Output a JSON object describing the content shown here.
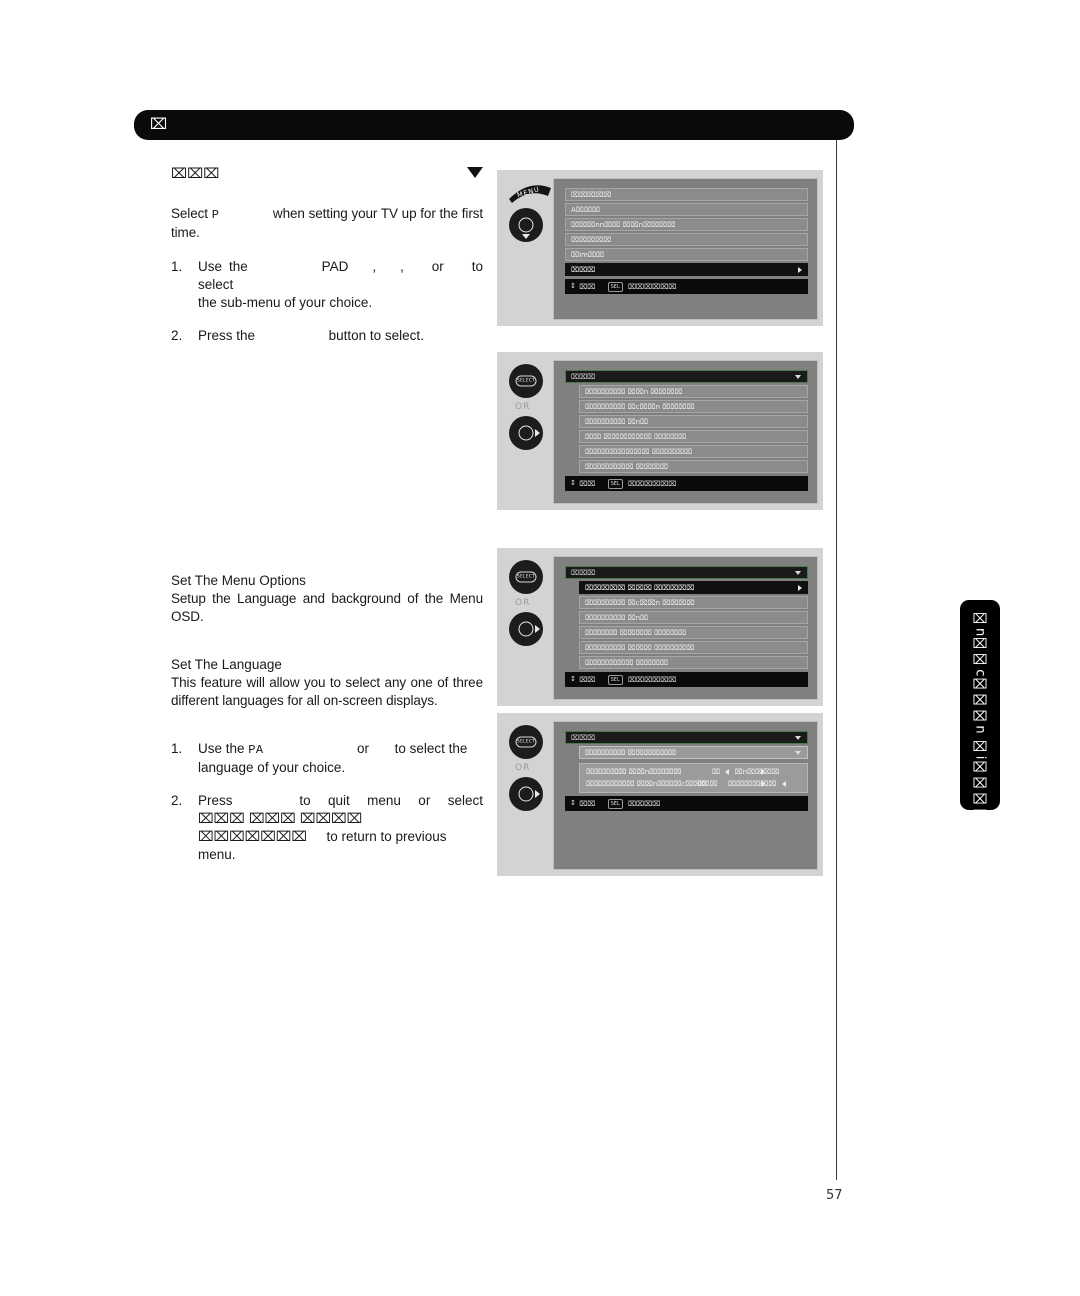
{
  "page": {
    "number": "57",
    "header_title": "⌧"
  },
  "side_tab": {
    "label": "⌧n⌧⌧c⌧⌧⌧n ⌧i⌧⌧⌧⌧"
  },
  "section": {
    "heading": "⌧⌧⌧",
    "intro_prefix": "Select",
    "intro_mono": "P",
    "intro_rest": "when setting your TV up for the first time.",
    "steps": [
      {
        "num": "1.",
        "line1_a": "Use the",
        "line1_b": "PAD",
        "line1_c": ",",
        "line1_d": ",",
        "line1_e": "or",
        "line1_f": "to select",
        "line2": "the sub-menu of your choice."
      },
      {
        "num": "2.",
        "line1_a": "Press the",
        "line1_b": "button to select."
      }
    ]
  },
  "menu_options": {
    "title": "Set The Menu Options",
    "body": "Setup the Language and background of the Menu OSD."
  },
  "language": {
    "title": "Set The Language",
    "body": "This feature will allow you to select any one of three different languages for all on-screen displays.",
    "steps": [
      {
        "num": "1.",
        "line1_a": "Use the",
        "line1_mono": "PA",
        "line1_b": "or",
        "line1_c": "to select the",
        "line2": "language of your choice."
      },
      {
        "num": "2.",
        "line1_a": "Press",
        "line1_b": "to quit menu or select",
        "line1_tofu": "⌧⌧⌧ ⌧⌧⌧ ⌧⌧⌧⌧",
        "line2_tofu": "⌧⌧⌧⌧⌧⌧⌧",
        "line2_b": "to return to previous menu."
      }
    ]
  },
  "figures": [
    {
      "name": "main-menu",
      "remote": {
        "menu_label": "MENU",
        "pad": "nav-pad-down"
      },
      "rows": [
        {
          "text": "⌧⌧⌧⌧⌧",
          "style": "plain"
        },
        {
          "text": "A⌧⌧⌧",
          "style": "plain"
        },
        {
          "text": "⌧⌧⌧nn⌧⌧ ⌧⌧n⌧⌧⌧⌧",
          "style": "plain"
        },
        {
          "text": "⌧⌧⌧⌧⌧",
          "style": "plain"
        },
        {
          "text": "⌧im⌧⌧",
          "style": "plain"
        },
        {
          "text": "⌧⌧⌧",
          "style": "hl",
          "caret": "right"
        }
      ],
      "footer": {
        "updown": "↕",
        "left": "⌧⌧",
        "key": "SEL",
        "right": "⌧⌧⌧⌧⌧⌧"
      }
    },
    {
      "name": "setup-submenu",
      "remote": {
        "select_label": "SELECT",
        "or_label": "OR",
        "pad": "nav-pad-right"
      },
      "header_row": {
        "text": "⌧⌧⌧",
        "caret": "down"
      },
      "rows": [
        {
          "text": "⌧⌧⌧⌧⌧ ⌧⌧n ⌧⌧⌧⌧",
          "style": "plain"
        },
        {
          "text": "⌧⌧⌧⌧⌧ ⌧c⌧⌧n ⌧⌧⌧⌧",
          "style": "plain"
        },
        {
          "text": "⌧⌧⌧⌧⌧ ⌧n⌧",
          "style": "plain"
        },
        {
          "text": "⌧⌧ ⌧⌧⌧⌧⌧⌧ ⌧⌧⌧⌧",
          "style": "plain"
        },
        {
          "text": "⌧⌧⌧⌧⌧⌧⌧⌧ ⌧⌧⌧⌧⌧",
          "style": "plain"
        },
        {
          "text": "⌧⌧⌧⌧⌧⌧ ⌧⌧⌧⌧",
          "style": "plain"
        }
      ],
      "footer": {
        "updown": "↕",
        "left": "⌧⌧",
        "key": "SEL",
        "right": "⌧⌧⌧⌧⌧⌧"
      }
    },
    {
      "name": "menu-options-submenu",
      "remote": {
        "select_label": "SELECT",
        "or_label": "OR",
        "pad": "nav-pad-right"
      },
      "header_row": {
        "text": "⌧⌧⌧",
        "caret": "down"
      },
      "rows": [
        {
          "text": "⌧⌧⌧⌧⌧ ⌧⌧⌧ ⌧⌧⌧⌧⌧",
          "style": "hl",
          "caret": "right"
        },
        {
          "text": "⌧⌧⌧⌧⌧ ⌧c⌧⌧n ⌧⌧⌧⌧",
          "style": "plain"
        },
        {
          "text": "⌧⌧⌧⌧⌧ ⌧n⌧",
          "style": "plain"
        },
        {
          "text": "⌧⌧⌧⌧ ⌧⌧⌧⌧ ⌧⌧⌧⌧",
          "style": "plain"
        },
        {
          "text": "⌧⌧⌧⌧⌧ ⌧⌧⌧ ⌧⌧⌧⌧⌧",
          "style": "plain"
        },
        {
          "text": "⌧⌧⌧⌧⌧⌧ ⌧⌧⌧⌧",
          "style": "plain"
        }
      ],
      "footer": {
        "updown": "↕",
        "left": "⌧⌧",
        "key": "SEL",
        "right": "⌧⌧⌧⌧⌧⌧"
      }
    },
    {
      "name": "language-settings",
      "remote": {
        "select_label": "SELECT",
        "or_label": "OR",
        "pad": "nav-pad-right"
      },
      "header_row": {
        "text": "⌧⌧⌧",
        "caret": "down"
      },
      "dropdown_row": {
        "text": "⌧⌧⌧⌧⌧ ⌧⌧⌧⌧⌧⌧",
        "caret": "down"
      },
      "value_rows": [
        {
          "label": "⌧⌧⌧⌧⌧ ⌧⌧n⌧⌧⌧⌧",
          "mid_mark": "⌧",
          "value": "⌧n⌧⌧⌧⌧"
        },
        {
          "label": "⌧⌧⌧⌧⌧⌧ ⌧⌧n⌧⌧⌧c⌧⌧⌧⌧",
          "mid_mark": "⌧",
          "value": "⌧⌧⌧⌧⌧⌧"
        }
      ],
      "footer": {
        "updown": "↕",
        "left": "⌧⌧",
        "key": "SEL",
        "right": "⌧⌧⌧⌧"
      }
    }
  ]
}
